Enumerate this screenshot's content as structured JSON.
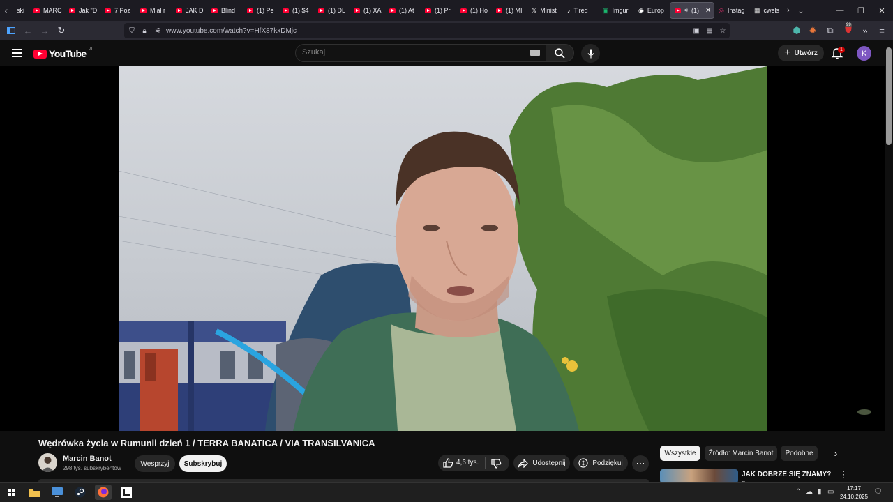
{
  "browser": {
    "tabs": [
      {
        "label": "ski",
        "icon": "none"
      },
      {
        "label": "MARC",
        "icon": "youtube"
      },
      {
        "label": "Jak \"D",
        "icon": "youtube"
      },
      {
        "label": "7 Poz",
        "icon": "youtube"
      },
      {
        "label": "Miał r",
        "icon": "youtube"
      },
      {
        "label": "JAK D",
        "icon": "youtube"
      },
      {
        "label": "Blind",
        "icon": "youtube"
      },
      {
        "label": "(1) Pe",
        "icon": "youtube"
      },
      {
        "label": "(1) $4",
        "icon": "youtube"
      },
      {
        "label": "(1) DL",
        "icon": "youtube"
      },
      {
        "label": "(1) XA",
        "icon": "youtube"
      },
      {
        "label": "(1) At",
        "icon": "youtube"
      },
      {
        "label": "(1) Pr",
        "icon": "youtube"
      },
      {
        "label": "(1) Ho",
        "icon": "youtube"
      },
      {
        "label": "(1) MI",
        "icon": "youtube"
      },
      {
        "label": "Minist",
        "icon": "x"
      },
      {
        "label": "Tired",
        "icon": "tiktok"
      },
      {
        "label": "Imgur",
        "icon": "imgur"
      },
      {
        "label": "Europ",
        "icon": "europe"
      },
      {
        "label": "(1)",
        "icon": "youtube",
        "active": true
      },
      {
        "label": "Instag",
        "icon": "instagram"
      },
      {
        "label": "cwels",
        "icon": "generic"
      }
    ],
    "url": "www.youtube.com/watch?v=HfX87kxDMjc",
    "extension_badge": "99"
  },
  "youtube": {
    "logo_text": "YouTube",
    "country_code": "PL",
    "search_placeholder": "Szukaj",
    "create_label": "Utwórz",
    "notification_count": "1",
    "avatar_letter": "K"
  },
  "video": {
    "title": "Wędrówka życia w Rumunii dzień 1 / TERRA BANATICA / VIA TRANSILVANICA",
    "channel_name": "Marcin Banot",
    "subscribers": "298 tys. subskrybentów",
    "support_label": "Wesprzyj",
    "subscribe_label": "Subskrybuj",
    "likes": "4,6 tys.",
    "share_label": "Udostępnij",
    "thanks_label": "Podziękuj"
  },
  "sidebar": {
    "chips": [
      {
        "label": "Wszystkie",
        "active": true
      },
      {
        "label": "Źródło: Marcin Banot",
        "active": false
      },
      {
        "label": "Podobne",
        "active": false
      }
    ],
    "recommendation": {
      "title": "JAK DOBRZE SIĘ ZNAMY?",
      "channel": "Rypsep"
    }
  },
  "taskbar": {
    "time": "17:17",
    "date": "24.10.2025"
  },
  "colors": {
    "brand_red": "#ff0033",
    "background": "#0f0f0f",
    "chip_bg": "#272727",
    "avatar": "#7e57c2"
  }
}
